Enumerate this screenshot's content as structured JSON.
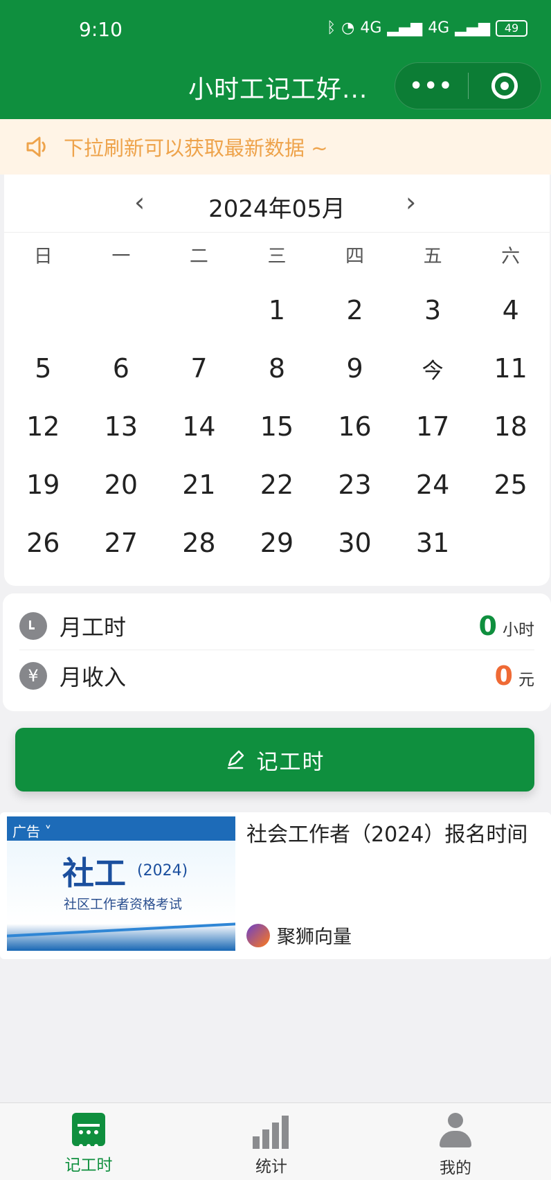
{
  "status_bar": {
    "time": "9:10",
    "network_1": "4G",
    "network_2": "4G",
    "battery": "49"
  },
  "header": {
    "title": "小时工记工好...",
    "more_label": "•••"
  },
  "notice": {
    "text": "下拉刷新可以获取最新数据 ~"
  },
  "calendar": {
    "month": "2024年05月",
    "prev": "‹",
    "next": "›",
    "weekdays": [
      "日",
      "一",
      "二",
      "三",
      "四",
      "五",
      "六"
    ],
    "days": [
      "",
      "",
      "",
      "1",
      "2",
      "3",
      "4",
      "5",
      "6",
      "7",
      "8",
      "9",
      "今",
      "11",
      "12",
      "13",
      "14",
      "15",
      "16",
      "17",
      "18",
      "19",
      "20",
      "21",
      "22",
      "23",
      "24",
      "25",
      "26",
      "27",
      "28",
      "29",
      "30",
      "31",
      ""
    ]
  },
  "summary": {
    "hours_label": "月工时",
    "hours_value": "0",
    "hours_unit": "小时",
    "income_label": "月收入",
    "income_value": "0",
    "income_unit": "元"
  },
  "actions": {
    "record_label": "记工时"
  },
  "ad": {
    "tag": "广告 ˅",
    "image_main": "社工",
    "image_year": "(2024)",
    "image_subtitle": "社区工作者资格考试",
    "title": "社会工作者（2024）报名时间",
    "brand": "聚狮向量"
  },
  "tabbar": {
    "items": [
      {
        "label": "记工时",
        "icon": "calendar-icon",
        "active": true
      },
      {
        "label": "统计",
        "icon": "chart-icon",
        "active": false
      },
      {
        "label": "我的",
        "icon": "user-icon",
        "active": false
      }
    ]
  },
  "colors": {
    "primary": "#0f8f3e",
    "notice_text": "#eea34b",
    "income": "#ef6a35"
  }
}
